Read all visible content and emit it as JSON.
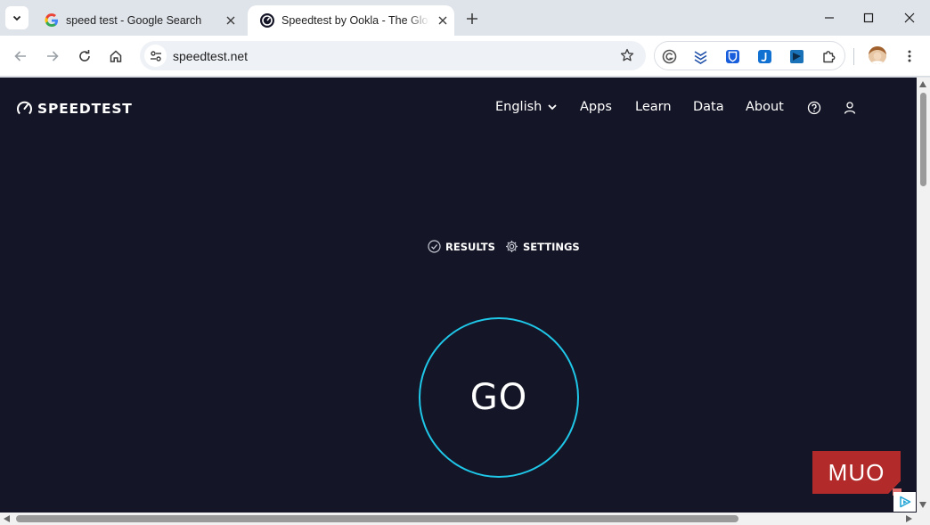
{
  "browser": {
    "tabs": [
      {
        "title": "speed test - Google Search",
        "icon": "google-icon"
      },
      {
        "title": "Speedtest by Ookla - The Global Broadband Speed Test",
        "icon": "speedtest-icon",
        "active": true
      }
    ],
    "address": {
      "url": "speedtest.net"
    }
  },
  "site": {
    "logo_text": "SPEEDTEST",
    "nav": {
      "language": "English",
      "apps": "Apps",
      "learn": "Learn",
      "data": "Data",
      "about": "About"
    },
    "subnav": {
      "results": "RESULTS",
      "settings": "SETTINGS"
    },
    "go_label": "GO"
  },
  "watermark": {
    "text": "MUO"
  },
  "colors": {
    "page_bg": "#141526",
    "go_ring": "#1fc7e8",
    "watermark": "#b22a2a"
  }
}
